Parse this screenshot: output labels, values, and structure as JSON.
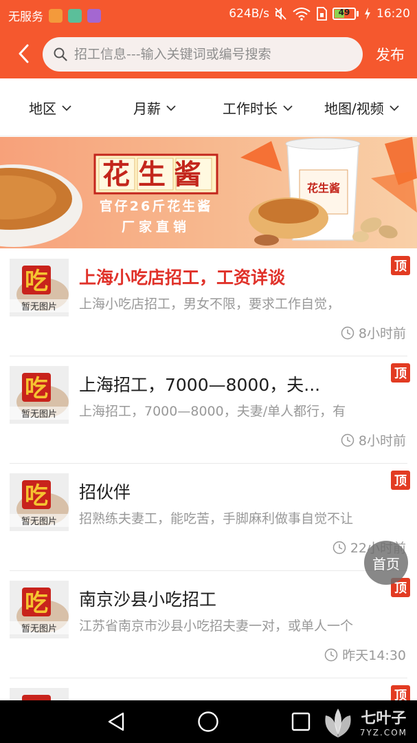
{
  "status_bar": {
    "carrier": "无服务",
    "net_speed": "624B/s",
    "battery_level": 49,
    "battery_text": "49",
    "time": "16:20",
    "icons": [
      "app-icon-orange",
      "app-icon-teal",
      "app-icon-purple",
      "mute-icon",
      "wifi-icon",
      "sim-icon",
      "battery-icon",
      "charging-icon"
    ]
  },
  "header": {
    "back_icon": "back-arrow-icon",
    "search_placeholder": "招工信息---输入关键词或编号搜索",
    "search_value": "",
    "publish_label": "发布"
  },
  "filters": [
    {
      "label": "地区"
    },
    {
      "label": "月薪"
    },
    {
      "label": "工作时长"
    },
    {
      "label": "地图/视频"
    }
  ],
  "banner": {
    "headline": "花生酱",
    "subline1": "官仔26斤花生酱",
    "subline2": "厂家直销",
    "product_label": "花生酱"
  },
  "list": [
    {
      "thumb_text": "暂无图片",
      "title": "上海小吃店招工，工资详谈",
      "title_highlight": true,
      "desc": "上海小吃店招工，男女不限，要求工作自觉，",
      "time": "8小时前",
      "badge": "顶"
    },
    {
      "thumb_text": "暂无图片",
      "title": "上海招工，7000—8000，夫...",
      "title_highlight": false,
      "desc": "上海招工，7000—8000，夫妻/单人都行，有",
      "time": "8小时前",
      "badge": "顶"
    },
    {
      "thumb_text": "暂无图片",
      "title": "招伙伴",
      "title_highlight": false,
      "desc": "招熟练夫妻工，能吃苦，手脚麻利做事自觉不让",
      "time": "22小时前",
      "badge": "顶"
    },
    {
      "thumb_text": "暂无图片",
      "title": "南京沙县小吃招工",
      "title_highlight": false,
      "desc": "江苏省南京市沙县小吃招夫妻一对，或单人一个",
      "time": "昨天14:30",
      "badge": "顶"
    }
  ],
  "floating_button": {
    "label": "首页"
  },
  "watermark": {
    "brand": "七叶子",
    "site": "7YZ.COM"
  },
  "colors": {
    "brand_orange": "#f5582e",
    "highlight_red": "#e0322a",
    "badge_red": "#e23b22"
  }
}
